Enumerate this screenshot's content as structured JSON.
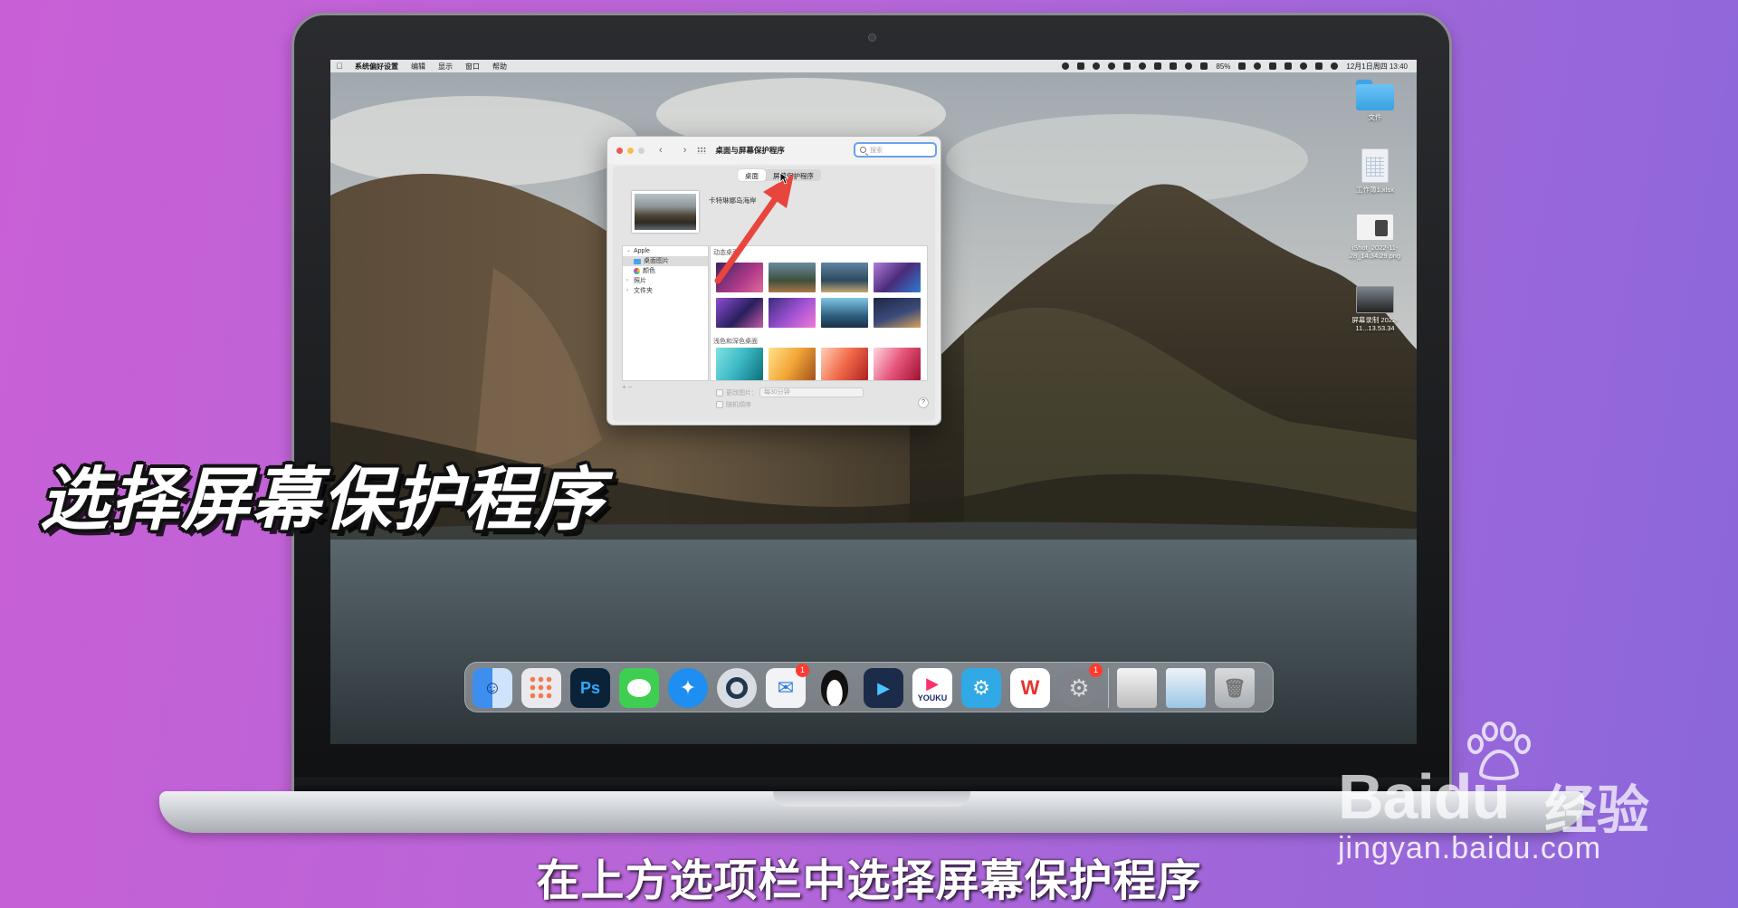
{
  "menubar": {
    "app_name": "系统偏好设置",
    "items": [
      "编辑",
      "显示",
      "窗口",
      "帮助"
    ],
    "battery": "85%",
    "clock": "12月1日周四 13:40"
  },
  "desktop_icons": [
    {
      "label": "文件",
      "kind": "folder"
    },
    {
      "label": "工作簿1.xlsx",
      "kind": "spreadsheet"
    },
    {
      "label": "iShot_2022-11-28_14.34.29.png",
      "kind": "image"
    },
    {
      "label": "屏幕录制 2022-11...13.53.34",
      "kind": "video"
    }
  ],
  "window": {
    "title": "桌面与屏幕保护程序",
    "search_placeholder": "搜索",
    "tabs": [
      {
        "label": "桌面",
        "selected": true
      },
      {
        "label": "屏幕保护程序",
        "selected": false
      }
    ],
    "wallpaper_name": "卡特琳娜岛海岸",
    "sidebar": {
      "group": "Apple",
      "items": [
        {
          "label": "桌面图片",
          "selected": true,
          "color": "#4aa3e8"
        },
        {
          "label": "颜色",
          "selected": false
        }
      ],
      "collapsed": [
        "照片",
        "文件夹"
      ]
    },
    "gallery_sections": [
      "动态桌面",
      "浅色和深色桌面"
    ],
    "add_remove": "+ −",
    "change_picture_label": "更改图片：",
    "interval_value": "每30分钟",
    "random_label": "随机顺序",
    "help_label": "?"
  },
  "dock": {
    "apps": [
      {
        "name": "Finder",
        "glyph": "finder-icon",
        "color": "#3e8ef0"
      },
      {
        "name": "Launchpad",
        "glyph": "launchpad-icon",
        "color": "#e9e9ee"
      },
      {
        "name": "Photoshop",
        "label": "Ps",
        "color": "#0b2338"
      },
      {
        "name": "Messages",
        "glyph": "messages-icon",
        "color": "#3ecf52"
      },
      {
        "name": "Safari",
        "glyph": "safari-icon",
        "color": "#1e8ef0"
      },
      {
        "name": "QuickTime",
        "glyph": "quicktime-icon",
        "color": "#d8dde3"
      },
      {
        "name": "Mail",
        "glyph": "mail-icon",
        "color": "#f1f3f6",
        "badge": "1"
      },
      {
        "name": "QQ",
        "glyph": "qq-penguin-icon",
        "color": "transparent"
      },
      {
        "name": "Video",
        "glyph": "video-player-icon",
        "color": "#1b2b4a"
      },
      {
        "name": "Youku",
        "label": "YOUKU",
        "color": "#ffffff"
      },
      {
        "name": "Robot",
        "glyph": "robot-icon",
        "color": "#30a9e6"
      },
      {
        "name": "WPS",
        "label": "W",
        "color": "#ffffff"
      },
      {
        "name": "System Preferences",
        "glyph": "gear-icon",
        "color": "#7f8389",
        "badge": "1"
      }
    ]
  },
  "overlay_title": "选择屏幕保护程序",
  "subtitle": "在上方选项栏中选择屏幕保护程序",
  "watermark": {
    "brand": "Baidu",
    "cn": "经验",
    "url": "jingyan.baidu.com"
  },
  "colors": {
    "background_left": "#c95fd6",
    "background_right": "#8a67da",
    "arrow": "#e8453c",
    "search_focus": "#6aa1ef"
  }
}
